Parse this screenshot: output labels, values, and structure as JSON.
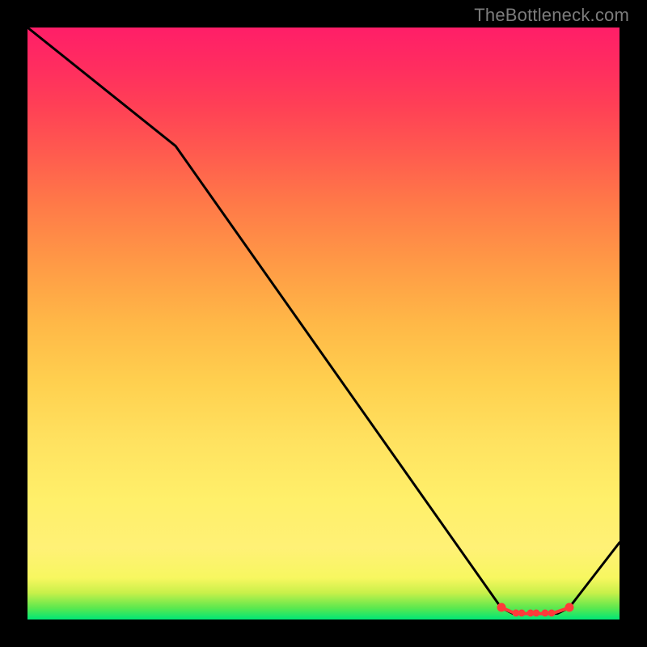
{
  "watermark": "TheBottleneck.com",
  "colors": {
    "background": "#000000",
    "curve": "#000000",
    "marker_red": "#ff3a3a",
    "gradient_top": "#ff1e68",
    "gradient_bottom": "#00e676"
  },
  "chart_data": {
    "type": "line",
    "title": "",
    "xlabel": "",
    "ylabel": "",
    "xlim": [
      0,
      100
    ],
    "ylim": [
      0,
      100
    ],
    "grid": false,
    "legend": false,
    "series": [
      {
        "name": "curve",
        "x": [
          0,
          25,
          80,
          82,
          85.5,
          88,
          89.5,
          91.5,
          100
        ],
        "values": [
          100,
          80,
          2,
          1,
          1,
          1,
          1,
          2,
          13
        ]
      }
    ],
    "markers": {
      "name": "flat-region",
      "x": [
        80,
        82.5,
        83.5,
        85,
        86,
        87.5,
        88.5,
        91.5
      ],
      "y": [
        2,
        1,
        1,
        1,
        1,
        1,
        1,
        2
      ],
      "color": "#ff3a3a"
    },
    "annotations": []
  }
}
